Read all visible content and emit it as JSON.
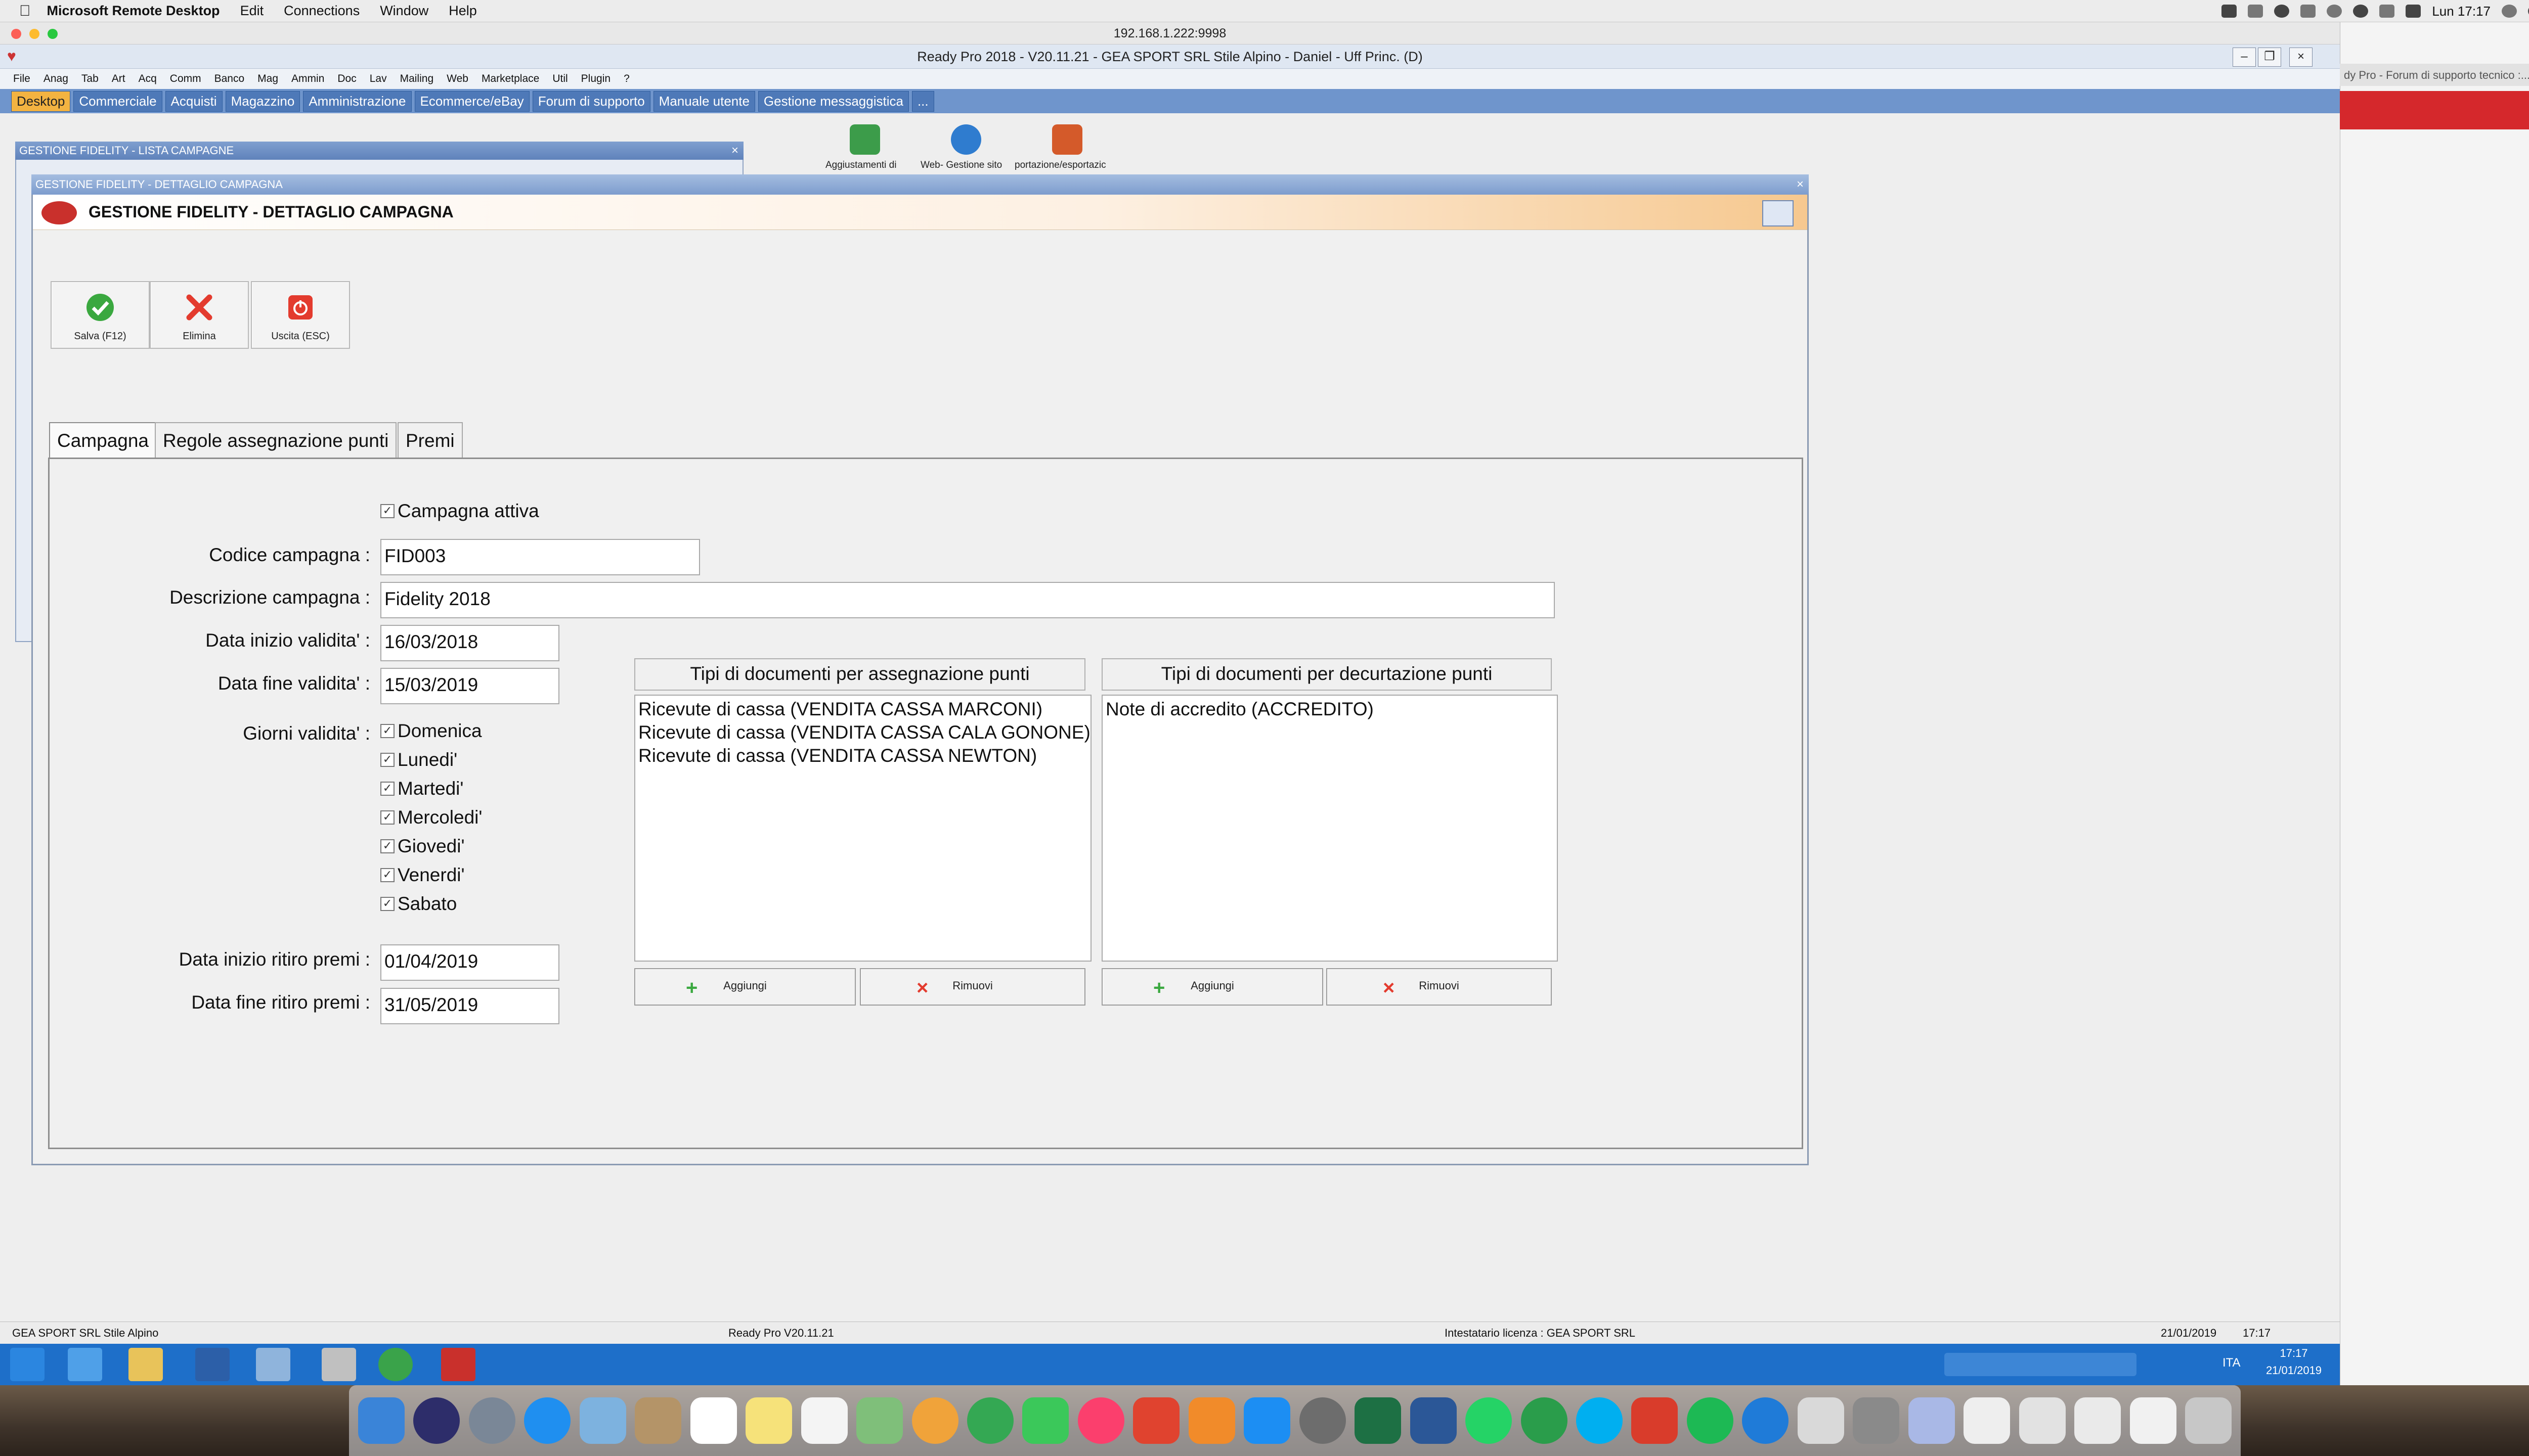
{
  "mac_menubar": {
    "app": "Microsoft Remote Desktop",
    "items": [
      "Edit",
      "Connections",
      "Window",
      "Help"
    ],
    "clock": "Lun 17:17"
  },
  "rdp": {
    "title": "192.168.1.222:9998"
  },
  "readypro": {
    "title": "Ready Pro 2018 - V20.11.21 - GEA SPORT SRL Stile Alpino - Daniel - Uff Princ. (D)",
    "menu": [
      "File",
      "Anag",
      "Tab",
      "Art",
      "Acq",
      "Comm",
      "Banco",
      "Mag",
      "Ammin",
      "Doc",
      "Lav",
      "Mailing",
      "Web",
      "Marketplace",
      "Util",
      "Plugin",
      "?"
    ],
    "tabs": [
      "Desktop",
      "Commerciale",
      "Acquisti",
      "Magazzino",
      "Amministrazione",
      "Ecommerce/eBay",
      "Forum di supporto",
      "Manuale utente",
      "Gestione messaggistica",
      "..."
    ],
    "toolbar_labels": [
      "Aggiustamenti di",
      "Web- Gestione sito",
      "portazione/esportazic"
    ]
  },
  "lista_window": {
    "title": "GESTIONE FIDELITY - LISTA CAMPAGNE"
  },
  "dialog": {
    "window_title": "GESTIONE FIDELITY - DETTAGLIO CAMPAGNA",
    "heading": "GESTIONE FIDELITY - DETTAGLIO CAMPAGNA",
    "buttons": {
      "save": "Salva (F12)",
      "delete": "Elimina",
      "exit": "Uscita (ESC)"
    },
    "tabs": [
      "Campagna",
      "Regole assegnazione punti",
      "Premi"
    ],
    "form": {
      "active_label": "Campagna attiva",
      "code_label": "Codice campagna :",
      "code_value": "FID003",
      "desc_label": "Descrizione campagna :",
      "desc_value": "Fidelity 2018",
      "start_label": "Data inizio validita' :",
      "start_value": "16/03/2018",
      "end_label": "Data fine validita' :",
      "end_value": "15/03/2019",
      "days_label": "Giorni validita' :",
      "days": [
        "Domenica",
        "Lunedi'",
        "Martedi'",
        "Mercoledi'",
        "Giovedi'",
        "Venerdi'",
        "Sabato"
      ],
      "redeem_start_label": "Data inizio ritiro premi :",
      "redeem_start_value": "01/04/2019",
      "redeem_end_label": "Data fine ritiro premi :",
      "redeem_end_value": "31/05/2019"
    },
    "assign_list": {
      "header": "Tipi di documenti per assegnazione punti",
      "items": [
        "Ricevute di cassa (VENDITA CASSA MARCONI)",
        "Ricevute di cassa (VENDITA CASSA CALA GONONE)",
        "Ricevute di cassa (VENDITA CASSA NEWTON)"
      ],
      "add": "Aggiungi",
      "remove": "Rimuovi"
    },
    "deduct_list": {
      "header": "Tipi di documenti per decurtazione punti",
      "items": [
        "Note di accredito (ACCREDITO)"
      ],
      "add": "Aggiungi",
      "remove": "Rimuovi"
    }
  },
  "status_bar": {
    "company": "GEA SPORT SRL Stile Alpino",
    "version": "Ready Pro V20.11.21",
    "license": "Intestatario licenza : GEA SPORT SRL",
    "date": "21/01/2019",
    "time": "17:17"
  },
  "taskbar": {
    "lang": "ITA",
    "time": "17:17",
    "date": "21/01/2019"
  },
  "browser_tab": "dy Pro - Forum di supporto tecnico :...",
  "colors": {
    "rp_tab_bar": "#6f95cc",
    "rp_tab_active": "#f3b341",
    "taskbar": "#1e6fc9",
    "browser_red": "#d5282c"
  }
}
